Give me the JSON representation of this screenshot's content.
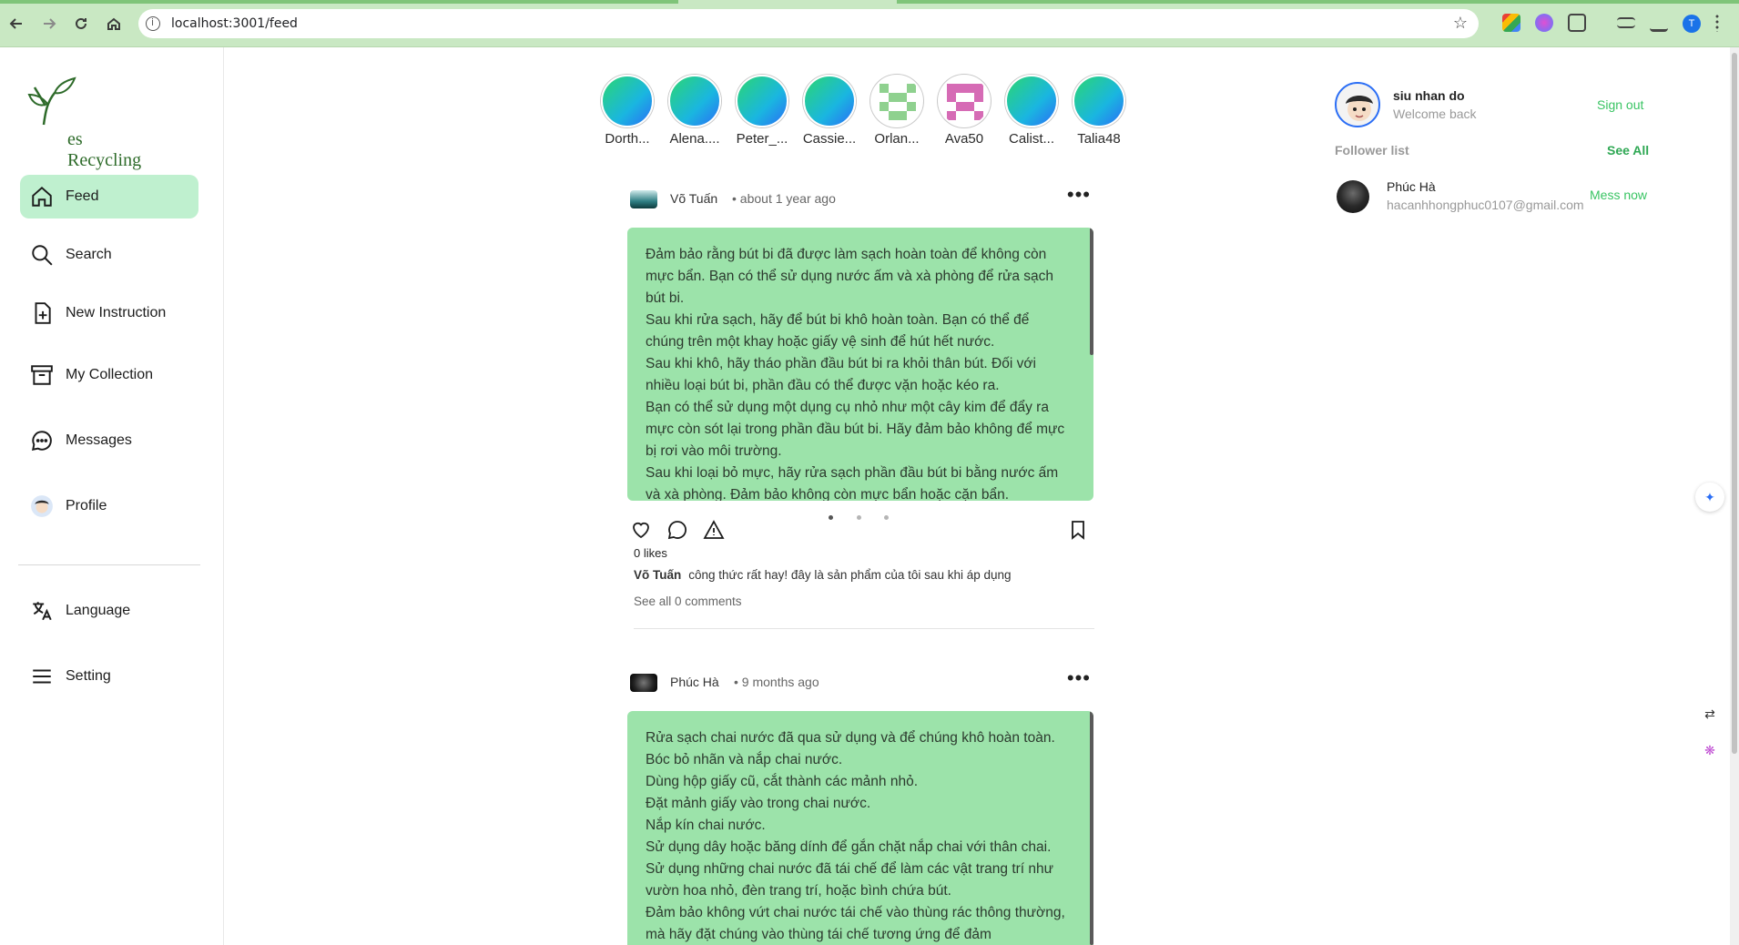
{
  "browser": {
    "url": "localhost:3001/feed",
    "profile_initial": "T"
  },
  "brand": {
    "logo_text": "es Recycling"
  },
  "nav": {
    "items": [
      {
        "label": "Feed",
        "icon": "home-icon"
      },
      {
        "label": "Search",
        "icon": "search-icon"
      },
      {
        "label": "New Instruction",
        "icon": "file-plus-icon"
      },
      {
        "label": "My Collection",
        "icon": "archive-icon"
      },
      {
        "label": "Messages",
        "icon": "chat-icon"
      },
      {
        "label": "Profile",
        "icon": "avatar-icon"
      },
      {
        "label": "Language",
        "icon": "translate-icon"
      },
      {
        "label": "Setting",
        "icon": "menu-icon"
      }
    ]
  },
  "stories": [
    {
      "name": "Dorth..."
    },
    {
      "name": "Alena...."
    },
    {
      "name": "Peter_..."
    },
    {
      "name": "Cassie..."
    },
    {
      "name": "Orlan..."
    },
    {
      "name": "Ava50"
    },
    {
      "name": "Calist..."
    },
    {
      "name": "Talia48"
    }
  ],
  "posts": [
    {
      "author": "Võ Tuấn",
      "time": "about 1 year ago",
      "content": [
        "Đảm bảo rằng bút bi đã được làm sạch hoàn toàn để không còn mực bẩn. Bạn có thể sử dụng nước ấm và xà phòng để rửa sạch bút bi.",
        "Sau khi rửa sạch, hãy để bút bi khô hoàn toàn. Bạn có thể để chúng trên một khay hoặc giấy vệ sinh để hút hết nước.",
        "Sau khi khô, hãy tháo phần đầu bút bi ra khỏi thân bút. Đối với nhiều loại bút bi, phần đầu có thể được vặn hoặc kéo ra.",
        "Bạn có thể sử dụng một dụng cụ nhỏ như một cây kim để đẩy ra mực còn sót lại trong phần đầu bút bi. Hãy đảm bảo không để mực bị rơi vào môi trường.",
        "Sau khi loại bỏ mực, hãy rửa sạch phần đầu bút bi bằng nước ấm và xà phòng. Đảm bảo không còn mực bẩn hoặc cặn bẩn."
      ],
      "likes": "0 likes",
      "caption_author": "Võ Tuấn",
      "caption_text": "công thức rất hay! đây là sản phẩm của tôi sau khi áp dụng",
      "comments_link": "See all 0 comments"
    },
    {
      "author": "Phúc Hà",
      "time": "9 months ago",
      "content": [
        "Rửa sạch chai nước đã qua sử dụng và để chúng khô hoàn toàn.",
        "Bóc bỏ nhãn và nắp chai nước.",
        "Dùng hộp giấy cũ, cắt thành các mảnh nhỏ.",
        "Đặt mảnh giấy vào trong chai nước.",
        "Nắp kín chai nước.",
        "Sử dụng dây hoặc băng dính để gắn chặt nắp chai với thân chai.",
        "Sử dụng những chai nước đã tái chế để làm các vật trang trí như vườn hoa nhỏ, đèn trang trí, hoặc bình chứa bút.",
        "Đảm bảo không vứt chai nước tái chế vào thùng rác thông thường, mà hãy đặt chúng vào thùng tái chế tương ứng để đảm"
      ]
    }
  ],
  "account": {
    "name": "siu nhan do",
    "subtitle": "Welcome back",
    "sign_out": "Sign out"
  },
  "followers": {
    "title": "Follower list",
    "see_all": "See All",
    "items": [
      {
        "name": "Phúc Hà",
        "email": "hacanhhongphuc0107@gmail.com",
        "action": "Mess now"
      }
    ]
  },
  "colors": {
    "accent_green": "#39c463",
    "card_green": "#9ce3aa",
    "active_nav": "#bff0cf"
  }
}
